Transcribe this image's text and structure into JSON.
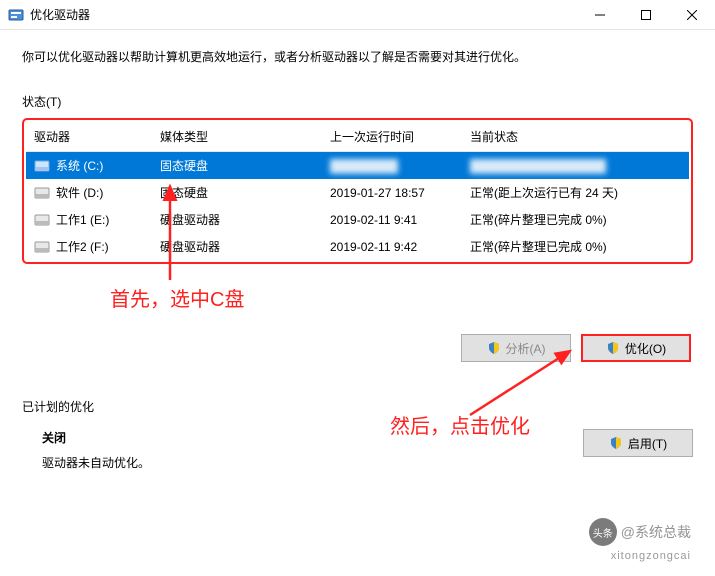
{
  "window": {
    "title": "优化驱动器"
  },
  "description": "你可以优化驱动器以帮助计算机更高效地运行，或者分析驱动器以了解是否需要对其进行优化。",
  "status_label": "状态(T)",
  "columns": {
    "drive": "驱动器",
    "media": "媒体类型",
    "last": "上一次运行时间",
    "state": "当前状态"
  },
  "drives": [
    {
      "name": "系统 (C:)",
      "media": "固态硬盘",
      "last": "",
      "state": "",
      "selected": true,
      "blurred": true
    },
    {
      "name": "软件 (D:)",
      "media": "固态硬盘",
      "last": "2019-01-27 18:57",
      "state": "正常(距上次运行已有 24 天)",
      "selected": false
    },
    {
      "name": "工作1 (E:)",
      "media": "硬盘驱动器",
      "last": "2019-02-11 9:41",
      "state": "正常(碎片整理已完成 0%)",
      "selected": false
    },
    {
      "name": "工作2 (F:)",
      "media": "硬盘驱动器",
      "last": "2019-02-11 9:42",
      "state": "正常(碎片整理已完成 0%)",
      "selected": false
    }
  ],
  "buttons": {
    "analyze": "分析(A)",
    "optimize": "优化(O)",
    "enable": "启用(T)",
    "close": "关闭(C)"
  },
  "schedule": {
    "title": "已计划的优化",
    "closed": "关闭",
    "desc": "驱动器未自动优化。"
  },
  "annotations": {
    "a1": "首先，选中C盘",
    "a2": "然后，点击优化"
  },
  "watermark": {
    "circle": "头条",
    "text": "@系统总裁",
    "sub": "xitongzongcai"
  }
}
